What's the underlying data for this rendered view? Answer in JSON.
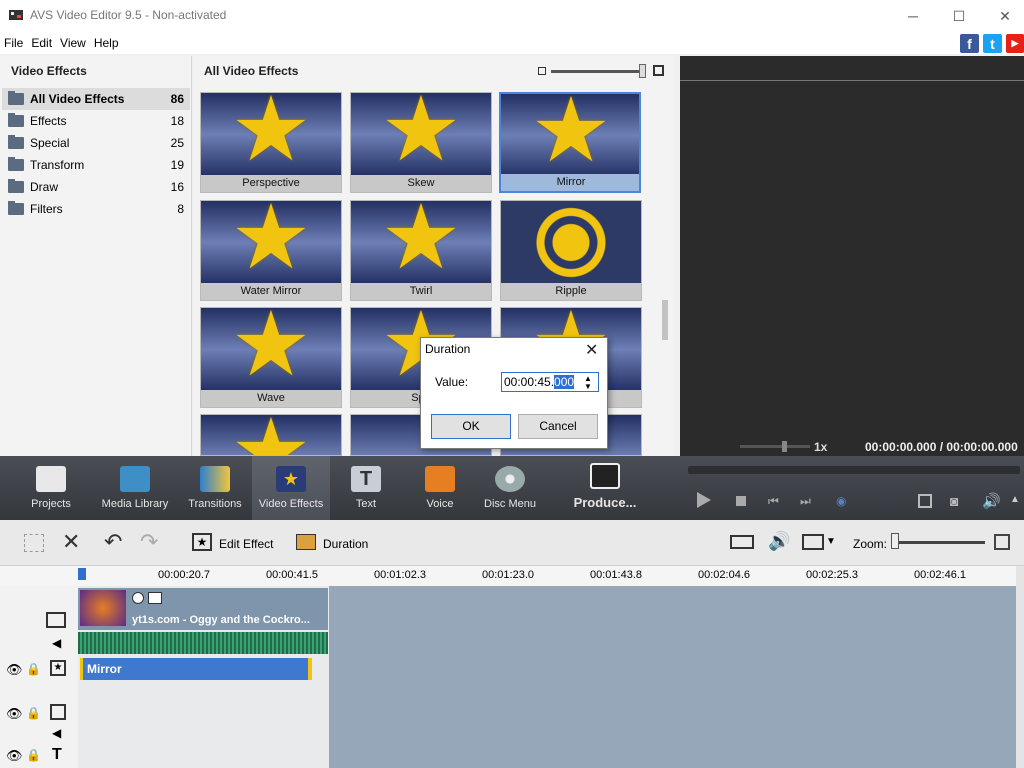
{
  "window": {
    "title": "AVS Video Editor 9.5 - Non-activated",
    "minimize": "─",
    "maximize": "☐",
    "close": "✕"
  },
  "menu": [
    "File",
    "Edit",
    "View",
    "Help"
  ],
  "social": {
    "facebook": "f",
    "twitter": "t",
    "youtube": "▶"
  },
  "left_panel": {
    "title": "Video Effects",
    "categories": [
      {
        "label": "All Video Effects",
        "count": "86"
      },
      {
        "label": "Effects",
        "count": "18"
      },
      {
        "label": "Special",
        "count": "25"
      },
      {
        "label": "Transform",
        "count": "19"
      },
      {
        "label": "Draw",
        "count": "16"
      },
      {
        "label": "Filters",
        "count": "8"
      }
    ]
  },
  "grid": {
    "title": "All Video Effects",
    "tiles": [
      "Perspective",
      "Skew",
      "Mirror",
      "Water Mirror",
      "Twirl",
      "Ripple",
      "Wave",
      "Sph",
      ""
    ]
  },
  "preview": {
    "speed": "1x",
    "time": "00:00:00.000 / 00:00:00.000"
  },
  "toolbar": [
    "Projects",
    "Media Library",
    "Transitions",
    "Video Effects",
    "Text",
    "Voice",
    "Disc Menu",
    "Produce..."
  ],
  "edit_toolbar": {
    "edit_effect": "Edit Effect",
    "duration": "Duration",
    "zoom": "Zoom:"
  },
  "ruler": [
    "00:00:20.7",
    "00:00:41.5",
    "00:01:02.3",
    "00:01:23.0",
    "00:01:43.8",
    "00:02:04.6",
    "00:02:25.3",
    "00:02:46.1"
  ],
  "clips": {
    "video": "yt1s.com - Oggy and the Cockro...",
    "effect": "Mirror"
  },
  "dialog": {
    "title": "Duration",
    "value_label": "Value:",
    "value_prefix": "00:00:45.",
    "value_selected": "000",
    "ok": "OK",
    "cancel": "Cancel"
  },
  "colors": {
    "accent": "#2f6fd0",
    "toolbar_bg": "#3d4046",
    "timeline_bg": "#95a7b8"
  }
}
